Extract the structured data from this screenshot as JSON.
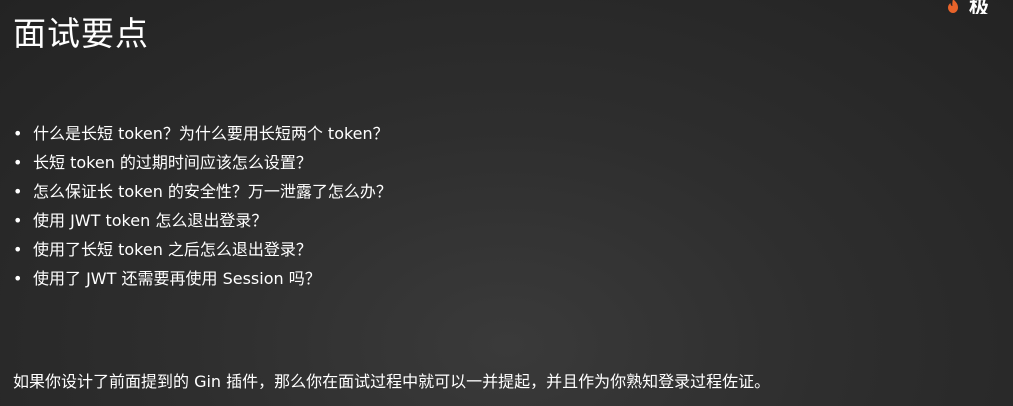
{
  "slide": {
    "title": "面试要点",
    "logo": {
      "text": "极",
      "icon": "flame-logo-icon",
      "accent": "#e8632a"
    },
    "bullet_symbol": "•",
    "bullets": [
      "什么是长短 token？为什么要用长短两个 token？",
      "长短 token 的过期时间应该怎么设置？",
      "怎么保证长 token 的安全性？万一泄露了怎么办？",
      "使用 JWT token 怎么退出登录？",
      "使用了长短 token 之后怎么退出登录？",
      "使用了 JWT 还需要再使用 Session 吗？"
    ],
    "footer": "如果你设计了前面提到的 Gin 插件，那么你在面试过程中就可以一并提起，并且作为你熟知登录过程佐证。"
  }
}
